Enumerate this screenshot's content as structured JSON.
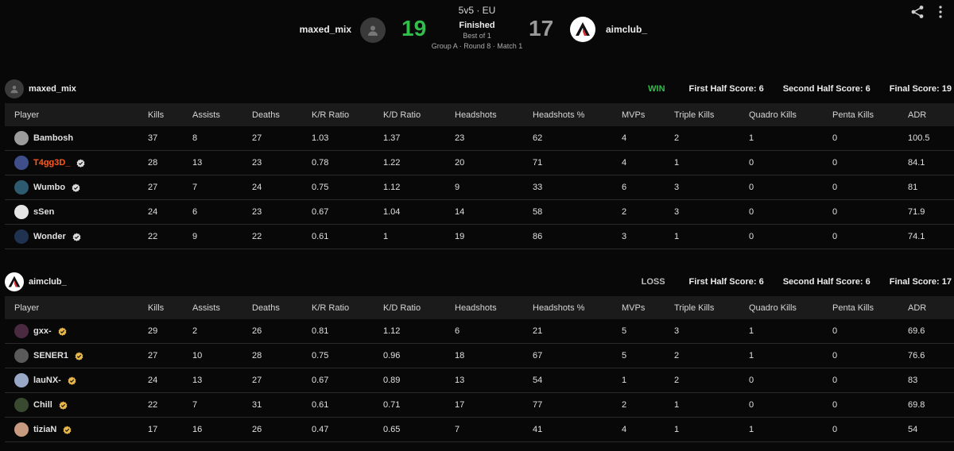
{
  "header": {
    "mode": "5v5 · EU",
    "status": "Finished",
    "best_of": "Best of 1",
    "info": "Group A · Round 8 · Match 1",
    "team_left": {
      "name": "maxed_mix",
      "score": "19"
    },
    "team_right": {
      "name": "aimclub_",
      "score": "17"
    },
    "colors": {
      "win": "#2fbf4a",
      "loss": "#9a9a9a",
      "highlight": "#ff5a1f"
    }
  },
  "columns": [
    "Player",
    "Kills",
    "Assists",
    "Deaths",
    "K/R Ratio",
    "K/D Ratio",
    "Headshots",
    "Headshots %",
    "MVPs",
    "Triple Kills",
    "Quadro Kills",
    "Penta Kills",
    "ADR"
  ],
  "teams": [
    {
      "name": "maxed_mix",
      "result": "WIN",
      "first_half": "First Half Score: 6",
      "second_half": "Second Half Score: 6",
      "final": "Final Score: 19",
      "players": [
        {
          "name": "Bambosh",
          "verified": false,
          "highlight": false,
          "avatar": "#9c9c9c",
          "stats": [
            "37",
            "8",
            "27",
            "1.03",
            "1.37",
            "23",
            "62",
            "4",
            "2",
            "1",
            "0",
            "100.5"
          ]
        },
        {
          "name": "T4gg3D_",
          "verified": true,
          "highlight": true,
          "avatar": "#3f4f8a",
          "stats": [
            "28",
            "13",
            "23",
            "0.78",
            "1.22",
            "20",
            "71",
            "4",
            "1",
            "0",
            "0",
            "84.1"
          ]
        },
        {
          "name": "Wumbo",
          "verified": true,
          "highlight": false,
          "avatar": "#2d5a6e",
          "stats": [
            "27",
            "7",
            "24",
            "0.75",
            "1.12",
            "9",
            "33",
            "6",
            "3",
            "0",
            "0",
            "81"
          ]
        },
        {
          "name": "sSen",
          "verified": false,
          "highlight": false,
          "avatar": "#e6e6e6",
          "stats": [
            "24",
            "6",
            "23",
            "0.67",
            "1.04",
            "14",
            "58",
            "2",
            "3",
            "0",
            "0",
            "71.9"
          ]
        },
        {
          "name": "Wonder",
          "verified": true,
          "highlight": false,
          "avatar": "#1f3350",
          "stats": [
            "22",
            "9",
            "22",
            "0.61",
            "1",
            "19",
            "86",
            "3",
            "1",
            "0",
            "0",
            "74.1"
          ]
        }
      ]
    },
    {
      "name": "aimclub_",
      "result": "LOSS",
      "first_half": "First Half Score: 6",
      "second_half": "Second Half Score: 6",
      "final": "Final Score: 17",
      "players": [
        {
          "name": "gxx-",
          "verified": true,
          "highlight": false,
          "avatar": "#4a2a40",
          "stats": [
            "29",
            "2",
            "26",
            "0.81",
            "1.12",
            "6",
            "21",
            "5",
            "3",
            "1",
            "0",
            "69.6"
          ]
        },
        {
          "name": "SENER1",
          "verified": true,
          "highlight": false,
          "avatar": "#5a5a5a",
          "stats": [
            "27",
            "10",
            "28",
            "0.75",
            "0.96",
            "18",
            "67",
            "5",
            "2",
            "1",
            "0",
            "76.6"
          ]
        },
        {
          "name": "lauNX-",
          "verified": true,
          "highlight": false,
          "avatar": "#9aa8c8",
          "stats": [
            "24",
            "13",
            "27",
            "0.67",
            "0.89",
            "13",
            "54",
            "1",
            "2",
            "0",
            "0",
            "83"
          ]
        },
        {
          "name": "Chill",
          "verified": true,
          "highlight": false,
          "avatar": "#3a4a30",
          "stats": [
            "22",
            "7",
            "31",
            "0.61",
            "0.71",
            "17",
            "77",
            "2",
            "1",
            "0",
            "0",
            "69.8"
          ]
        },
        {
          "name": "tiziaN",
          "verified": true,
          "highlight": false,
          "avatar": "#c89a80",
          "stats": [
            "17",
            "16",
            "26",
            "0.47",
            "0.65",
            "7",
            "41",
            "4",
            "1",
            "1",
            "0",
            "54"
          ]
        }
      ]
    }
  ]
}
